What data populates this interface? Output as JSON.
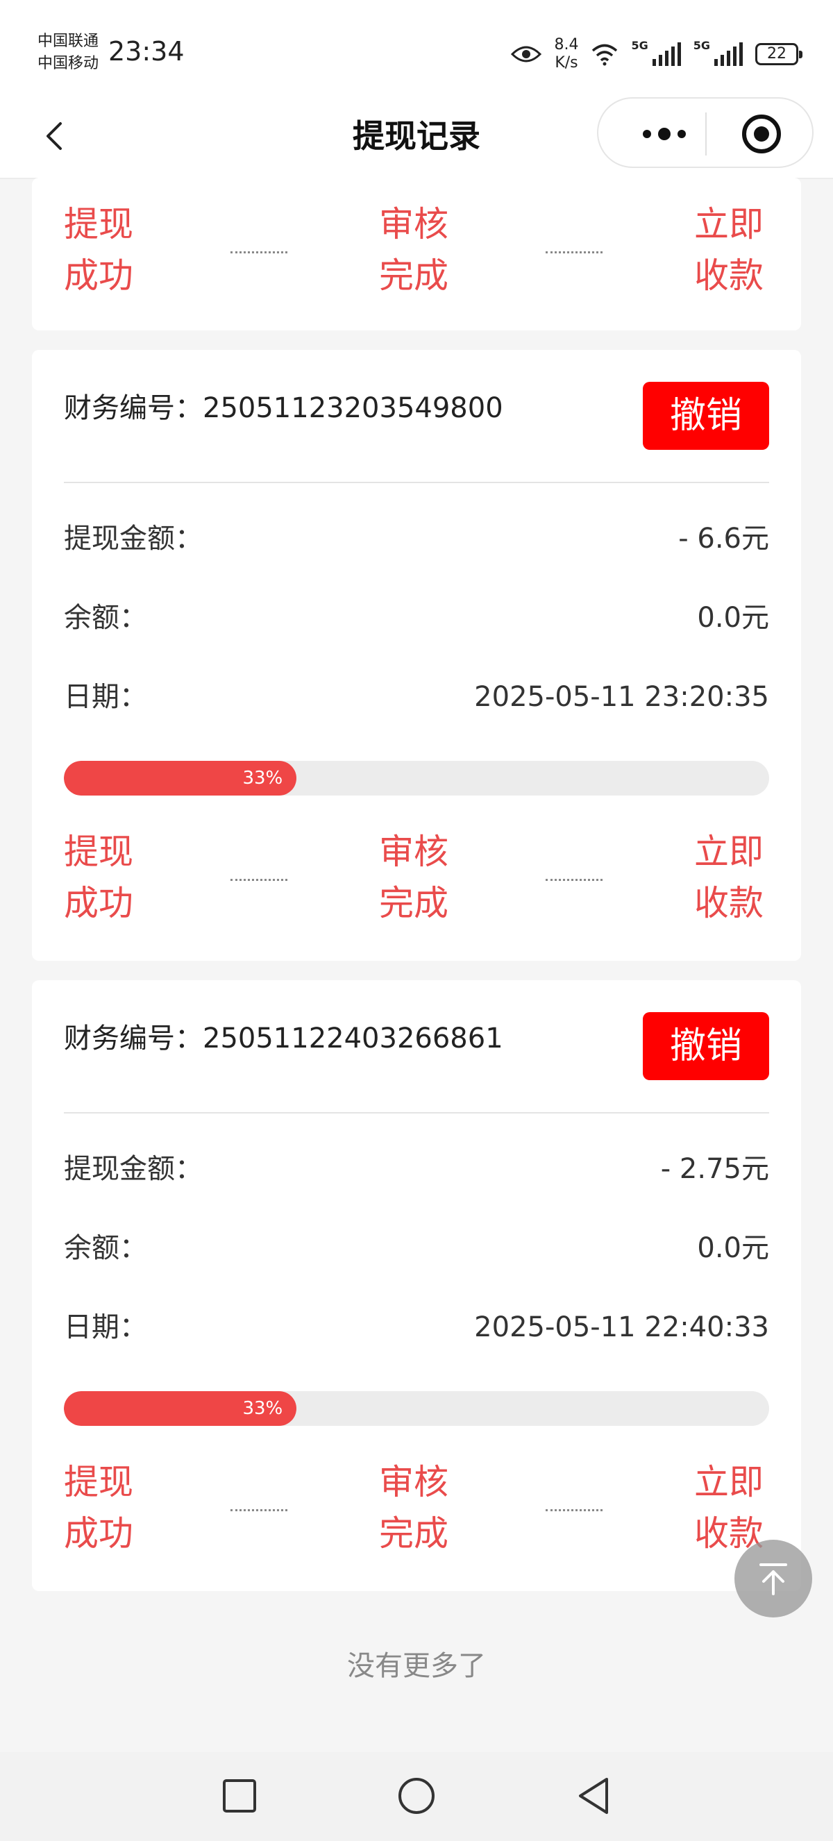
{
  "status_bar": {
    "carrier_1": "中国联通",
    "carrier_2": "中国移动",
    "time": "23:34",
    "net_speed_value": "8.4",
    "net_speed_unit": "K/s",
    "signal_1_tag": "5G",
    "signal_2_tag": "5G",
    "battery": "22"
  },
  "nav": {
    "title": "提现记录"
  },
  "steps_labels": {
    "step1": "提现成功",
    "step2": "审核完成",
    "step3": "立即收款"
  },
  "records": [
    {
      "id_label": "财务编号：",
      "id_value": "25051123203549800",
      "cancel_label": "撤销",
      "amount_label": "提现金额：",
      "amount_value": "- 6.6元",
      "balance_label": "余额：",
      "balance_value": "0.0元",
      "date_label": "日期：",
      "date_value": "2025-05-11 23:20:35",
      "progress_text": "33%",
      "progress_percent": 33
    },
    {
      "id_label": "财务编号：",
      "id_value": "25051122403266861",
      "cancel_label": "撤销",
      "amount_label": "提现金额：",
      "amount_value": "- 2.75元",
      "balance_label": "余额：",
      "balance_value": "0.0元",
      "date_label": "日期：",
      "date_value": "2025-05-11 22:40:33",
      "progress_text": "33%",
      "progress_percent": 33
    }
  ],
  "footer": {
    "no_more": "没有更多了"
  },
  "colors": {
    "accent_red": "#e94b4b",
    "cancel_red": "#ff0000",
    "progress_red": "#ef4646"
  },
  "icons": {
    "back": "chevron-left-icon",
    "more": "more-dots-icon",
    "close": "target-close-icon",
    "to_top": "arrow-up-to-top-icon"
  }
}
